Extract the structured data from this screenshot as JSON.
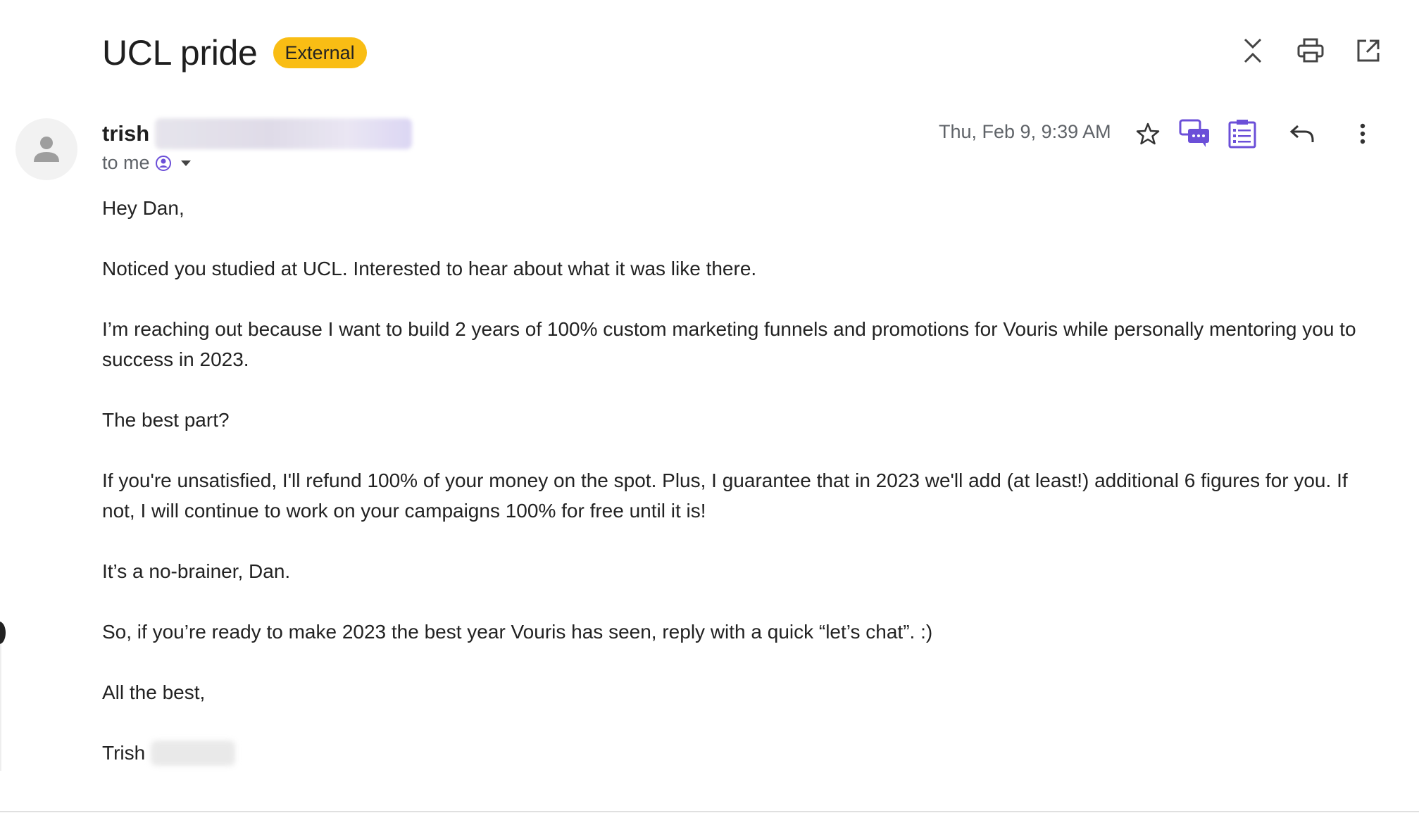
{
  "subject": {
    "title": "UCL pride",
    "badge": "External"
  },
  "top_actions": {
    "icons": [
      "collapse-all-icon",
      "print-icon",
      "open-in-new-window-icon"
    ]
  },
  "sender": {
    "name": "trish",
    "to_label": "to me"
  },
  "message": {
    "date": "Thu, Feb 9, 9:39 AM"
  },
  "message_actions": {
    "icons": [
      "star-icon",
      "chat-bubbles-icon",
      "checklist-icon",
      "reply-icon",
      "more-vert-icon"
    ]
  },
  "body": {
    "greeting": "Hey Dan,",
    "paragraphs": [
      "Noticed you studied at UCL. Interested to hear about what it was like there.",
      "I’m reaching out because I want to build 2 years of 100% custom marketing funnels and promotions for Vouris while personally mentoring you to success in 2023.",
      "The best part?",
      "If you're unsatisfied, I'll refund 100% of your money on the spot. Plus, I guarantee that in 2023 we'll add (at least!) additional 6 figures for you. If not, I will continue to work on your campaigns 100% for free until it is!",
      "It’s a no-brainer, Dan.",
      "So, if you’re ready to make 2023 the best year Vouris has seen, reply with a quick “let’s chat”. :)"
    ],
    "closing": "All the best,",
    "signature": "Trish"
  },
  "colors": {
    "badge": "#f9bd14",
    "accent_purple": "#6b4fd8",
    "meta_gray": "#5f6368"
  }
}
